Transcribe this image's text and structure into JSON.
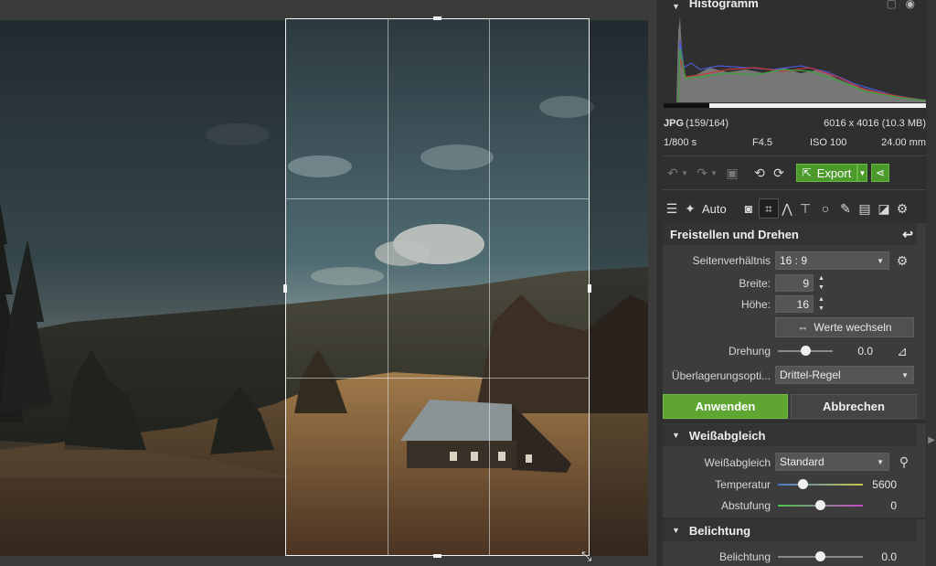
{
  "histogram": {
    "title": "Histogramm",
    "format": "JPG",
    "index": "(159/164)",
    "dimensions": "6016 x 4016 (10.3 MB)",
    "shutter": "1/800 s",
    "aperture": "F4.5",
    "iso": "ISO 100",
    "focal": "24.00 mm"
  },
  "toolbar": {
    "export_label": "Export",
    "auto_label": "Auto"
  },
  "crop": {
    "title": "Freistellen und Drehen",
    "aspect_label": "Seitenverhältnis",
    "aspect_value": "16 : 9",
    "width_label": "Breite:",
    "width_value": "9",
    "height_label": "Höhe:",
    "height_value": "16",
    "swap_label": "Werte wechseln",
    "rotation_label": "Drehung",
    "rotation_value": "0.0",
    "rotation_level": 0.5,
    "overlay_label": "Überlagerungsopti...",
    "overlay_value": "Drittel-Regel",
    "apply_label": "Anwenden",
    "cancel_label": "Abbrechen"
  },
  "whitebalance": {
    "title": "Weißabgleich",
    "wb_label": "Weißabgleich",
    "wb_value": "Standard",
    "temp_label": "Temperatur",
    "temp_value": "5600",
    "temp_level": 0.3,
    "tint_label": "Abstufung",
    "tint_value": "0",
    "tint_level": 0.5
  },
  "exposure": {
    "title": "Belichtung",
    "exp_label": "Belichtung",
    "exp_value": "0.0",
    "exp_level": 0.5
  },
  "colors": {
    "apply_green": "#5ea532",
    "export_green": "#4d9a2c"
  }
}
